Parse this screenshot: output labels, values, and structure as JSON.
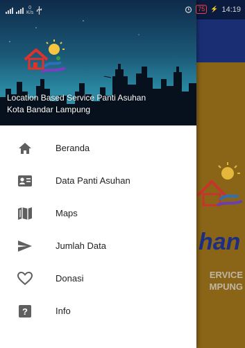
{
  "status_bar": {
    "net_speed_top": "0",
    "net_speed_bottom": "K/s",
    "battery": "75",
    "time": "14:19"
  },
  "drawer": {
    "header": {
      "title": "Location Based Service Panti Asuhan",
      "subtitle": "Kota Bandar Lampung"
    },
    "menu": [
      {
        "label": "Beranda",
        "icon": "home-icon"
      },
      {
        "label": "Data Panti Asuhan",
        "icon": "id-card-icon"
      },
      {
        "label": "Maps",
        "icon": "map-icon"
      },
      {
        "label": "Jumlah Data",
        "icon": "send-icon"
      },
      {
        "label": "Donasi",
        "icon": "heart-icon"
      },
      {
        "label": "Info",
        "icon": "help-icon"
      }
    ]
  },
  "background_app": {
    "big_text": "han",
    "sub_text_line1": "ERVICE",
    "sub_text_line2": "MPUNG"
  },
  "colors": {
    "icon": "#5f5f5f",
    "toolbar": "#1a2f73"
  }
}
